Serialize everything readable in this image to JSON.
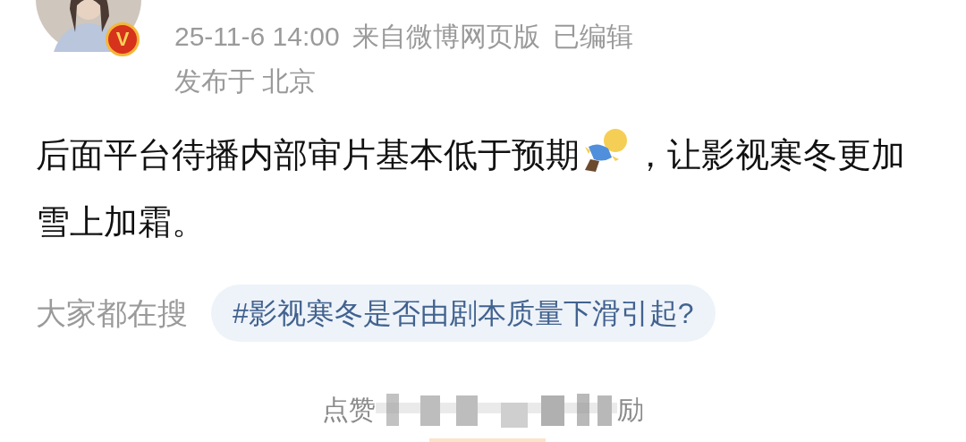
{
  "author": {
    "badge": "V"
  },
  "meta": {
    "time": "25-11-6 14:00",
    "source": "来自微博网页版",
    "edited": "已编辑",
    "location": "发布于 北京"
  },
  "body": {
    "text_before": "后面平台待播内部审片基本低于预期",
    "text_after": "，让影视寒冬更加雪上加霜。"
  },
  "search_suggest": {
    "label": "大家都在搜",
    "topic": "#影视寒冬是否由剧本质量下滑引起?"
  },
  "footer": {
    "text_start": "点赞",
    "text_end": "励"
  }
}
